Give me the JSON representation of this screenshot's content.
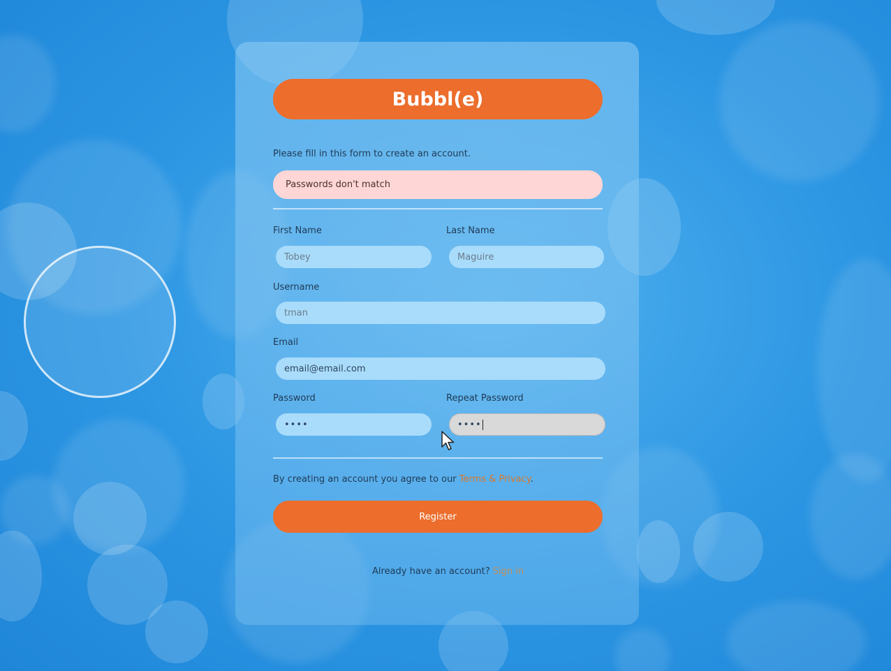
{
  "brand": {
    "name": "Bubbl(e)"
  },
  "intro_text": "Please fill in this form to create an account.",
  "error_alert": "Passwords don't match",
  "form": {
    "first_name": {
      "label": "First Name",
      "value": "Tobey"
    },
    "last_name": {
      "label": "Last Name",
      "value": "Maguire"
    },
    "username": {
      "label": "Username",
      "value": "tman"
    },
    "email": {
      "label": "Email",
      "value": "email@email.com"
    },
    "password": {
      "label": "Password",
      "value": "••••"
    },
    "repeat_password": {
      "label": "Repeat Password",
      "value": "••••"
    }
  },
  "terms": {
    "prefix": "By creating an account you agree to our ",
    "link": "Terms & Privacy",
    "suffix": "."
  },
  "register_button": "Register",
  "signin": {
    "prefix": "Already have an account? ",
    "link": "Sign in"
  },
  "colors": {
    "accent": "#ec6d2c",
    "alert_bg": "#ffd6d6",
    "input_bg": "#a9dcfb",
    "background": "#2c96e3"
  }
}
